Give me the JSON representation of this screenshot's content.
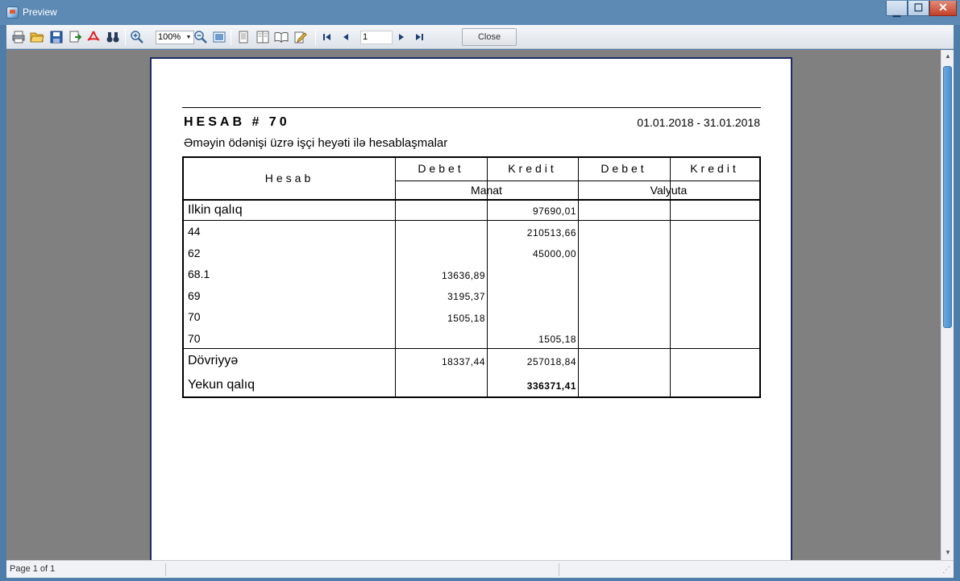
{
  "window": {
    "title": "Preview"
  },
  "toolbar": {
    "zoom": "100%",
    "page_number": "1",
    "close_label": "Close"
  },
  "report": {
    "title": "HESAB # 70",
    "period": "01.01.2018 - 31.01.2018",
    "subtitle": "Əməyin ödənişi üzrə işçi heyəti ilə hesablaşmalar",
    "headers": {
      "account": "Hesab",
      "debit": "Debet",
      "credit": "Kredit",
      "debit2": "Debet",
      "credit2": "Kredit",
      "currency1": "Manat",
      "currency2": "Valyuta"
    },
    "opening": {
      "label": "Ilkin qalıq",
      "debit": "",
      "credit": "97690,01"
    },
    "rows": [
      {
        "account": "44",
        "debit": "",
        "credit": "210513,66"
      },
      {
        "account": "62",
        "debit": "",
        "credit": "45000,00"
      },
      {
        "account": "68.1",
        "debit": "13636,89",
        "credit": ""
      },
      {
        "account": "69",
        "debit": "3195,37",
        "credit": ""
      },
      {
        "account": "70",
        "debit": "1505,18",
        "credit": ""
      },
      {
        "account": "70",
        "debit": "",
        "credit": "1505,18"
      }
    ],
    "turnover": {
      "label": "Dövriyyə",
      "debit": "18337,44",
      "credit": "257018,84"
    },
    "closing": {
      "label": "Yekun qalıq",
      "debit": "",
      "credit": "336371,41"
    }
  },
  "status": {
    "page_info": "Page 1 of 1"
  }
}
